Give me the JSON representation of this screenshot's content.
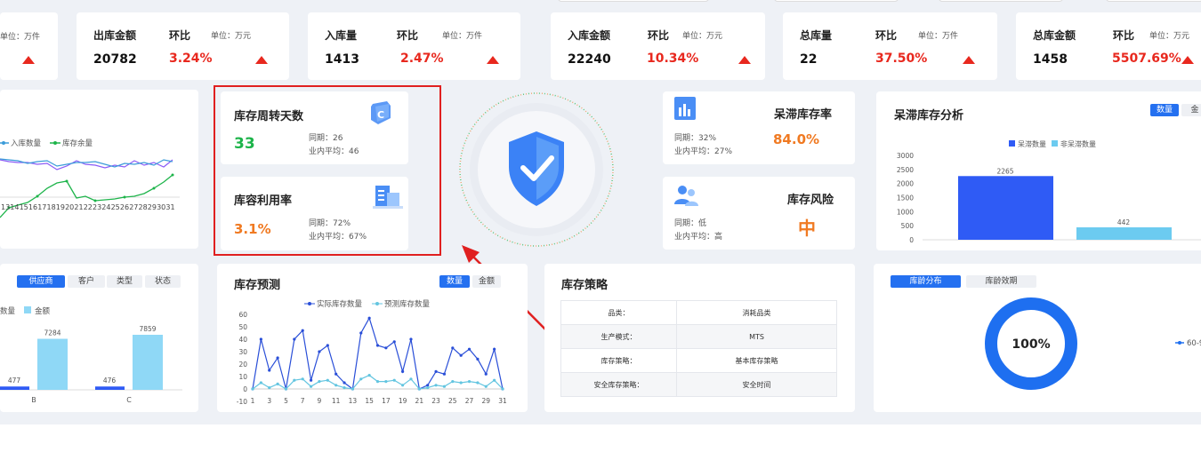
{
  "kpis": [
    {
      "label": "",
      "ratio_label": "",
      "unit": "单位：万件",
      "value": "",
      "pct": ""
    },
    {
      "label": "出库金额",
      "ratio_label": "环比",
      "unit": "单位：万元",
      "value": "20782",
      "pct": "3.24%"
    },
    {
      "label": "入库量",
      "ratio_label": "环比",
      "unit": "单位：万件",
      "value": "1413",
      "pct": "2.47%"
    },
    {
      "label": "入库金额",
      "ratio_label": "环比",
      "unit": "单位：万元",
      "value": "22240",
      "pct": "10.34%"
    },
    {
      "label": "总库量",
      "ratio_label": "环比",
      "unit": "单位：万件",
      "value": "22",
      "pct": "37.50%"
    },
    {
      "label": "总库金额",
      "ratio_label": "环比",
      "unit": "单位：万元",
      "value": "1458",
      "pct": "5507.69%"
    }
  ],
  "colors": {
    "accent": "#2470f0",
    "up": "#e8281e",
    "green": "#1db44a",
    "orange": "#f07a22",
    "highlight_border": "#e02020"
  },
  "inout_chart": {
    "legend": [
      "入库数量",
      "库存余量"
    ],
    "x_labels": [
      "13",
      "14",
      "15",
      "16",
      "17",
      "18",
      "19",
      "20",
      "21",
      "22",
      "23",
      "24",
      "25",
      "26",
      "27",
      "28",
      "29",
      "30",
      "31"
    ]
  },
  "turnover": {
    "title": "库存周转天数",
    "value": "33",
    "same_period": "同期：26",
    "industry_avg": "业内平均：46",
    "icon": "calendar-badge-icon"
  },
  "capacity": {
    "title": "库容利用率",
    "value": "3.1%",
    "same_period": "同期：72%",
    "industry_avg": "业内平均：67%",
    "icon": "building-icon"
  },
  "center_icon": "shield-check-icon",
  "stagnant_rate": {
    "title": "呆滞库存率",
    "value": "84.0%",
    "same_period": "同期：32%",
    "industry_avg": "业内平均：27%",
    "icon": "bar-doc-icon"
  },
  "risk": {
    "title": "库存风险",
    "value": "中",
    "same_period": "同期：低",
    "industry_avg": "业内平均：高",
    "icon": "users-icon"
  },
  "stagnant_analysis": {
    "title": "呆滞库存分析",
    "tabs": [
      "数量",
      "金"
    ],
    "chart_data": {
      "type": "bar",
      "series": [
        {
          "name": "呆滞数量",
          "values": [
            2265
          ],
          "color": "#2f5bf5"
        },
        {
          "name": "非呆滞数量",
          "values": [
            442
          ],
          "color": "#6ccbf0"
        }
      ],
      "y_ticks": [
        "3000",
        "2500",
        "2000",
        "1500",
        "1000",
        "500",
        "0"
      ],
      "ylim": [
        0,
        3000
      ]
    }
  },
  "supplier": {
    "tabs": [
      "供应商",
      "客户",
      "类型",
      "状态"
    ],
    "legend": [
      "数量",
      "金额"
    ],
    "chart_data": {
      "type": "bar",
      "categories": [
        "B",
        "C"
      ],
      "series": [
        {
          "name": "数量",
          "values": [
            477,
            476
          ],
          "color": "#2f5bf5"
        },
        {
          "name": "金额",
          "values": [
            7284,
            7859
          ],
          "color": "#8fd8f6"
        }
      ]
    }
  },
  "forecast": {
    "title": "库存预测",
    "tabs": [
      "数量",
      "金额"
    ],
    "legend": [
      "实际库存数量",
      "预测库存数量"
    ],
    "chart_data": {
      "type": "line",
      "x": [
        1,
        2,
        3,
        4,
        5,
        6,
        7,
        8,
        9,
        10,
        11,
        12,
        13,
        14,
        15,
        16,
        17,
        18,
        19,
        20,
        21,
        22,
        23,
        24,
        25,
        26,
        27,
        28,
        29,
        30,
        31
      ],
      "x_tick_labels": [
        "1",
        "3",
        "5",
        "7",
        "9",
        "11",
        "13",
        "15",
        "17",
        "19",
        "21",
        "23",
        "25",
        "27",
        "29",
        "31"
      ],
      "y_ticks": [
        "60",
        "50",
        "40",
        "30",
        "20",
        "10",
        "0",
        "-10"
      ],
      "ylim": [
        -10,
        60
      ],
      "series": [
        {
          "name": "实际库存数量",
          "values": [
            0,
            40,
            15,
            25,
            0,
            40,
            47,
            7,
            30,
            35,
            12,
            5,
            0,
            45,
            57,
            35,
            33,
            38,
            14,
            40,
            0,
            3,
            14,
            12,
            33,
            27,
            32,
            24,
            12,
            32,
            0
          ],
          "color": "#2a4fd8"
        },
        {
          "name": "预测库存数量",
          "values": [
            0,
            5,
            1,
            4,
            0,
            7,
            8,
            2,
            6,
            7,
            3,
            1,
            0,
            8,
            11,
            6,
            6,
            7,
            3,
            8,
            0,
            1,
            3,
            2,
            6,
            5,
            6,
            5,
            2,
            7,
            0
          ],
          "color": "#63c5e0"
        }
      ]
    }
  },
  "strategy": {
    "title": "库存策略",
    "rows": [
      {
        "label": "品类：",
        "value": "消耗品类"
      },
      {
        "label": "生产模式：",
        "value": "MTS"
      },
      {
        "label": "库存策略：",
        "value": "基本库存策略"
      },
      {
        "label": "安全库存策略：",
        "value": "安全时间"
      }
    ]
  },
  "age": {
    "tabs": [
      "库龄分布",
      "库龄效期"
    ],
    "chart_data": {
      "type": "pie",
      "values": [
        100
      ],
      "center_label": "100%"
    },
    "legend": "60-9"
  }
}
